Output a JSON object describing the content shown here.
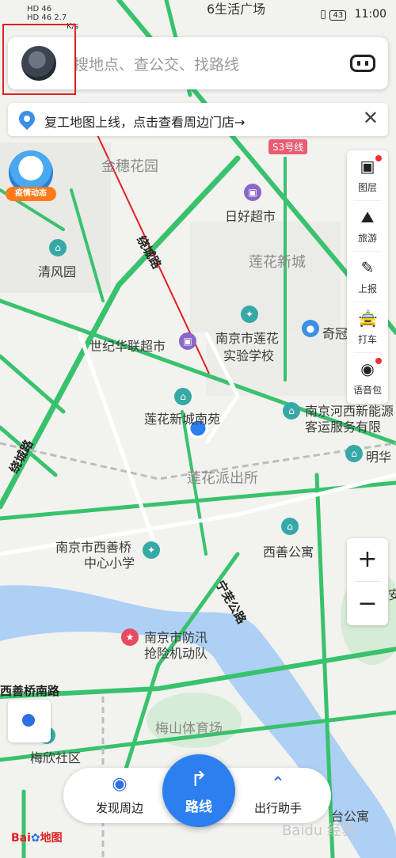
{
  "status": {
    "left_lines": [
      "HD 46",
      "HD 46  2.7",
      "K/s"
    ],
    "battery": "43",
    "time": "11:00"
  },
  "search": {
    "placeholder": "搜地点、查公交、找路线",
    "avatar_icon": "user-avatar",
    "voice_icon": "voice-assistant-icon"
  },
  "banner": {
    "text": "复工地图上线，点击查看周边门店→",
    "close": "✕"
  },
  "epidemic": {
    "label": "疫情动态"
  },
  "side_tools": [
    {
      "label": "图层",
      "icon": "layers-icon",
      "glyph": "▣",
      "dot": true
    },
    {
      "label": "旅游",
      "icon": "travel-icon",
      "glyph": "⛰",
      "dot": false
    },
    {
      "label": "上报",
      "icon": "report-icon",
      "glyph": "✎",
      "dot": false
    },
    {
      "label": "打车",
      "icon": "taxi-icon",
      "glyph": "🚖",
      "dot": false
    },
    {
      "label": "语音包",
      "icon": "voice-pack-icon",
      "glyph": "◉",
      "dot": true
    }
  ],
  "zoom": {
    "in": "+",
    "out": "−"
  },
  "map_labels": {
    "jinsui": "金穗花园",
    "rihao": "日好超市",
    "lianhua_newcity": "莲花新城",
    "qingfeng": "清风园",
    "raocheng1": "绕城路",
    "shiji": "世纪华联超市",
    "school1": "南京市莲花",
    "school2": "实验学校",
    "qiji": "奇冠",
    "lianhua_nanyuan": "莲花新城南苑",
    "station1": "南京河西新能源",
    "station2": "客运服务有限",
    "raocheng2": "绕城路",
    "minghua": "明华",
    "police": "莲花派出所",
    "xishan_school1": "南京市西善桥",
    "xishan_school2": "中心小学",
    "xishan_apt": "西善公寓",
    "ningwu": "宁芜公路",
    "flood1": "南京市防汛",
    "flood2": "抢险机动队",
    "xishanqiao_road": "西善桥南路",
    "meishan": "梅山体育场",
    "meixin": "梅欣社区",
    "s3": "S3号线",
    "an": "安",
    "bottom_apt": "台公寓",
    "top_market": "6生活广场"
  },
  "bottom": {
    "discover": "发现周边",
    "route": "路线",
    "assistant": "出行助手"
  },
  "logo": {
    "bai": "Bai",
    "du": "du",
    "ditu": "地图"
  },
  "watermark": "Baidu 经验"
}
